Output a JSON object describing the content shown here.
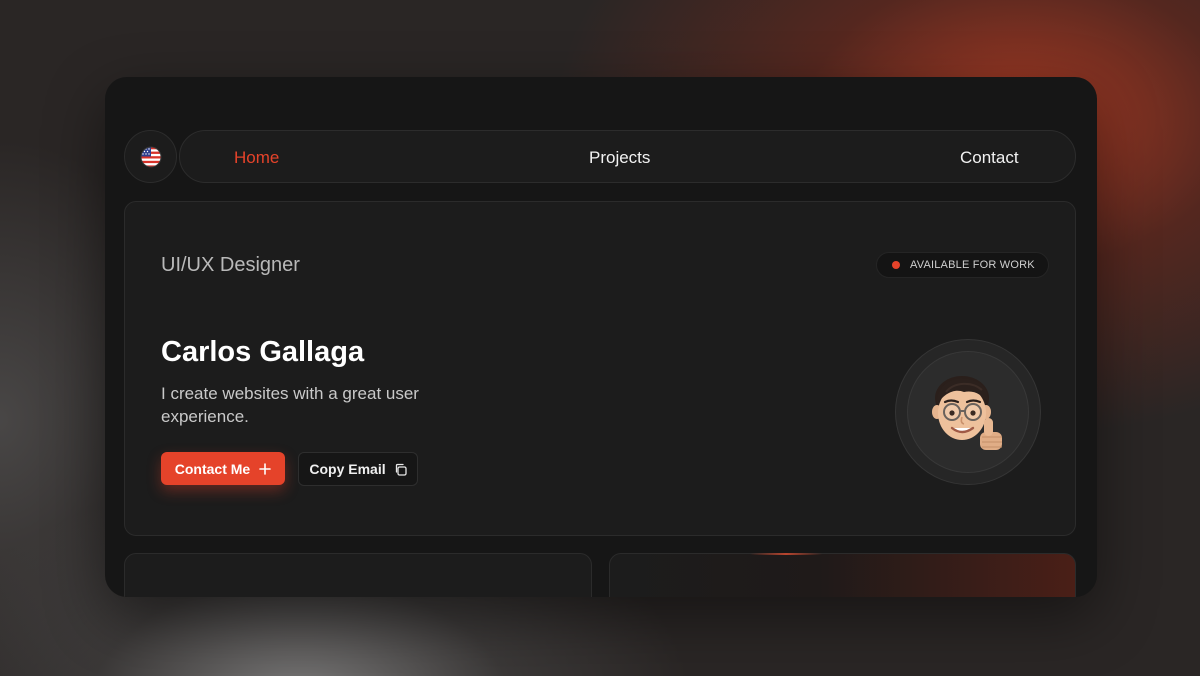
{
  "nav": {
    "language_flag": "us-flag-icon",
    "links": [
      {
        "label": "Home",
        "active": true
      },
      {
        "label": "Projects",
        "active": false
      },
      {
        "label": "Contact",
        "active": false
      }
    ]
  },
  "hero": {
    "role": "UI/UX Designer",
    "availability": "AVAILABLE FOR WORK",
    "name": "Carlos Gallaga",
    "tagline": "I create websites with a great user experience.",
    "primary_button": {
      "label": "Contact Me",
      "icon": "plus-icon"
    },
    "secondary_button": {
      "label": "Copy Email",
      "icon": "copy-icon"
    },
    "avatar": "memoji-thumbs-up-avatar"
  },
  "colors": {
    "accent": "#e5432a",
    "window_bg": "#161616",
    "card_bg": "#1c1c1c",
    "text_primary": "#ffffff",
    "text_muted": "#b9b9b9"
  }
}
